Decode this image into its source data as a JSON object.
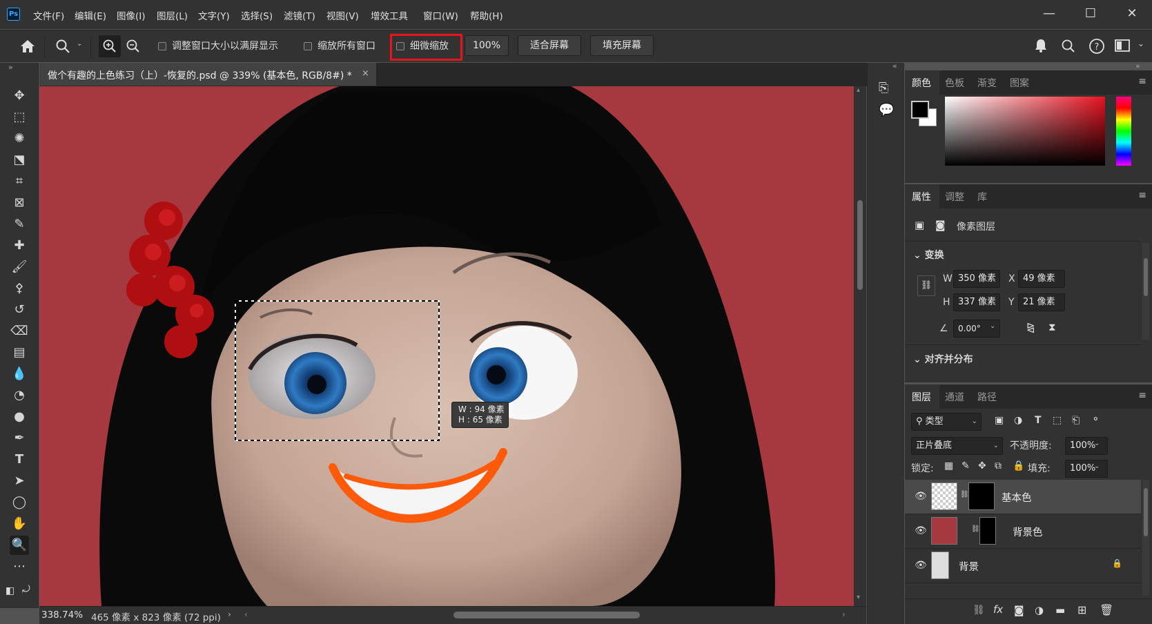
{
  "app": {
    "logo_text": "Ps"
  },
  "menu": [
    "文件(F)",
    "编辑(E)",
    "图像(I)",
    "图层(L)",
    "文字(Y)",
    "选择(S)",
    "滤镜(T)",
    "视图(V)",
    "增效工具",
    "窗口(W)",
    "帮助(H)"
  ],
  "window_controls": {
    "minimize": "—",
    "maximize": "☐",
    "close": "✕"
  },
  "options": {
    "resize_windows_label": "调整窗口大小以满屏显示",
    "zoom_all_windows_label": "缩放所有窗口",
    "scrubby_zoom_label": "细微缩放",
    "zoom_100": "100%",
    "fit_screen": "适合屏幕",
    "fill_screen": "填充屏幕"
  },
  "document": {
    "tab_title": "做个有趣的上色练习（上）-恢复的.psd @ 339% (基本色, RGB/8#) *",
    "close_symbol": "×"
  },
  "marquee_tooltip": {
    "w": "W : 94 像素",
    "h": "H : 65 像素"
  },
  "status": {
    "zoom": "338.74%",
    "doc_size": "465 像素 x 823 像素 (72 ppi)"
  },
  "color_panel": {
    "tabs": [
      "颜色",
      "色板",
      "渐变",
      "图案"
    ],
    "foreground": "#000000",
    "background": "#ffffff"
  },
  "properties_panel": {
    "tabs": [
      "属性",
      "调整",
      "库"
    ],
    "layer_type": "像素图层",
    "transform_label": "变换",
    "w_label": "W",
    "w_value": "350 像素",
    "h_label": "H",
    "h_value": "337 像素",
    "x_label": "X",
    "x_value": "49 像素",
    "y_label": "Y",
    "y_value": "21 像素",
    "angle_value": "0.00°",
    "align_label": "对齐并分布"
  },
  "layers_panel": {
    "tabs": [
      "图层",
      "通道",
      "路径"
    ],
    "filter_kind": "类型",
    "blend_mode": "正片叠底",
    "opacity_label": "不透明度:",
    "opacity_value": "100%",
    "lock_label": "锁定:",
    "fill_label": "填充:",
    "fill_value": "100%",
    "layers": [
      {
        "name": "基本色",
        "selected": true
      },
      {
        "name": "背景色",
        "selected": false
      },
      {
        "name": "背景",
        "selected": false
      }
    ]
  },
  "colors": {
    "canvas_bg": "#a6383f",
    "highlight": "#e8141c",
    "ui_dark": "#323232"
  }
}
